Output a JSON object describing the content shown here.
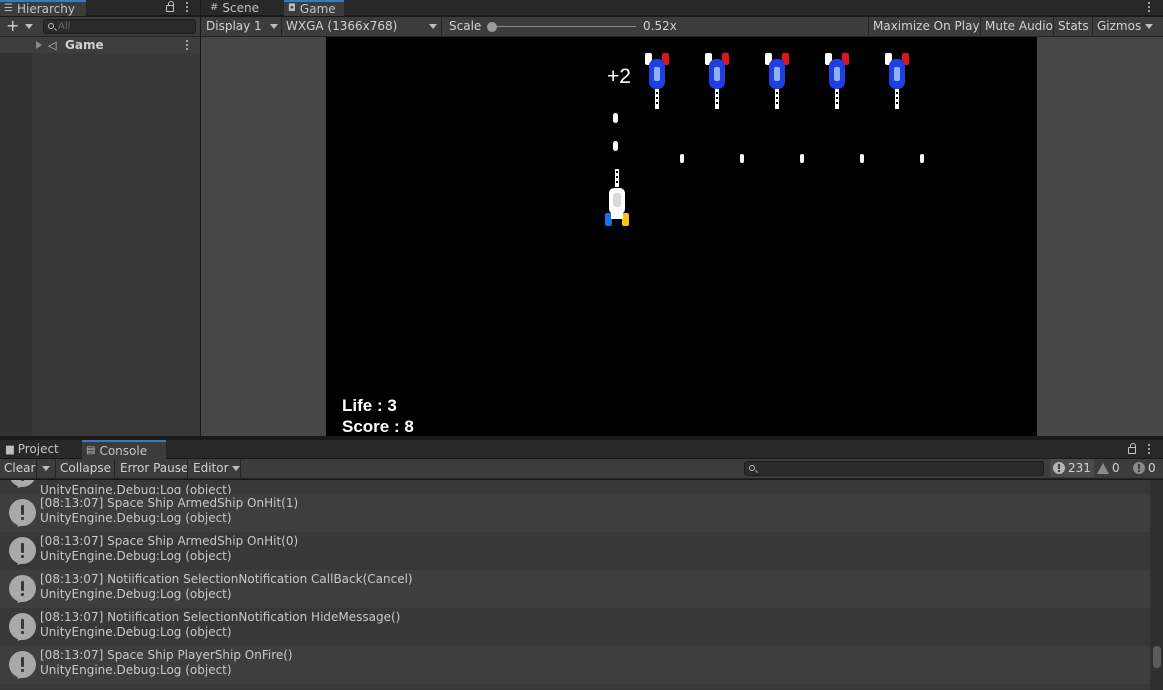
{
  "hierarchy": {
    "tab_label": "Hierarchy",
    "search_placeholder": "All",
    "root_item": "Game"
  },
  "view_tabs": [
    {
      "label": "Scene",
      "icon": "grid-icon"
    },
    {
      "label": "Game",
      "icon": "gamepad-icon"
    }
  ],
  "game_toolbar": {
    "display": "Display 1",
    "resolution": "WXGA (1366x768)",
    "scale_label": "Scale",
    "scale_value": "0.52x",
    "maximize": "Maximize On Play",
    "mute": "Mute Audio",
    "stats": "Stats",
    "gizmos": "Gizmos"
  },
  "game": {
    "popup_score": "+2",
    "life": "Life : 3",
    "score": "Score : 8",
    "colors": {
      "enemy_body": "#1f3fe0",
      "enemy_fin": "#e0141e",
      "player_left": "#1e6ee6",
      "player_right": "#f0c814"
    }
  },
  "bottom_tabs": [
    {
      "label": "Project",
      "icon": "folder-icon"
    },
    {
      "label": "Console",
      "icon": "console-icon"
    }
  ],
  "console_toolbar": {
    "clear": "Clear",
    "collapse": "Collapse",
    "error_pause": "Error Pause",
    "editor": "Editor",
    "info_count": "231",
    "warning_count": "0",
    "error_count": "0"
  },
  "logs": {
    "partial": "UnityEngine.Debug:Log (object)",
    "entries": [
      {
        "message": "[08:13:07] Space Ship ArmedShip OnHit(1)",
        "trace": "UnityEngine.Debug:Log (object)"
      },
      {
        "message": "[08:13:07] Space Ship ArmedShip OnHit(0)",
        "trace": "UnityEngine.Debug:Log (object)"
      },
      {
        "message": "[08:13:07] Notiification SelectionNotification CallBack(Cancel)",
        "trace": "UnityEngine.Debug:Log (object)"
      },
      {
        "message": "[08:13:07] Notiification SelectionNotification HideMessage()",
        "trace": "UnityEngine.Debug:Log (object)"
      },
      {
        "message": "[08:13:07] Space Ship PlayerShip OnFire()",
        "trace": "UnityEngine.Debug:Log (object)"
      }
    ]
  }
}
